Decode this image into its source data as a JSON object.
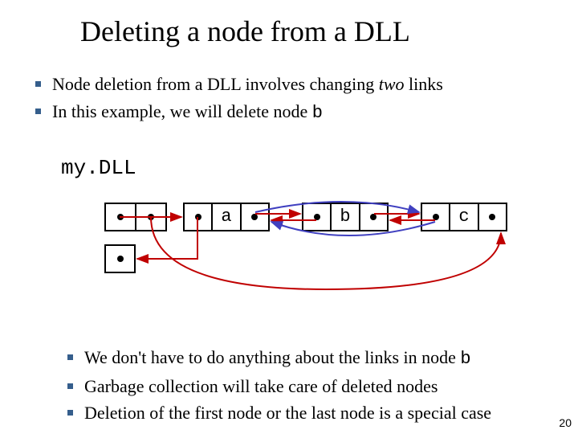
{
  "title": "Deleting a node from a DLL",
  "top_bullets": {
    "b0_part1": "Node deletion from a DLL involves changing ",
    "b0_italic": "two",
    "b0_part2": " links",
    "b1_part1": "In this example, we will delete node ",
    "b1_code": "b"
  },
  "mydll_label": "my.DLL",
  "nodes": {
    "a": "a",
    "b": "b",
    "c": "c"
  },
  "bottom_bullets": {
    "b0_part1": "We don't have to do anything about the links in node ",
    "b0_code": "b",
    "b1": "Garbage collection will take care of deleted nodes",
    "b2": "Deletion of the first node or the last node is a special case"
  },
  "page_number": "20"
}
